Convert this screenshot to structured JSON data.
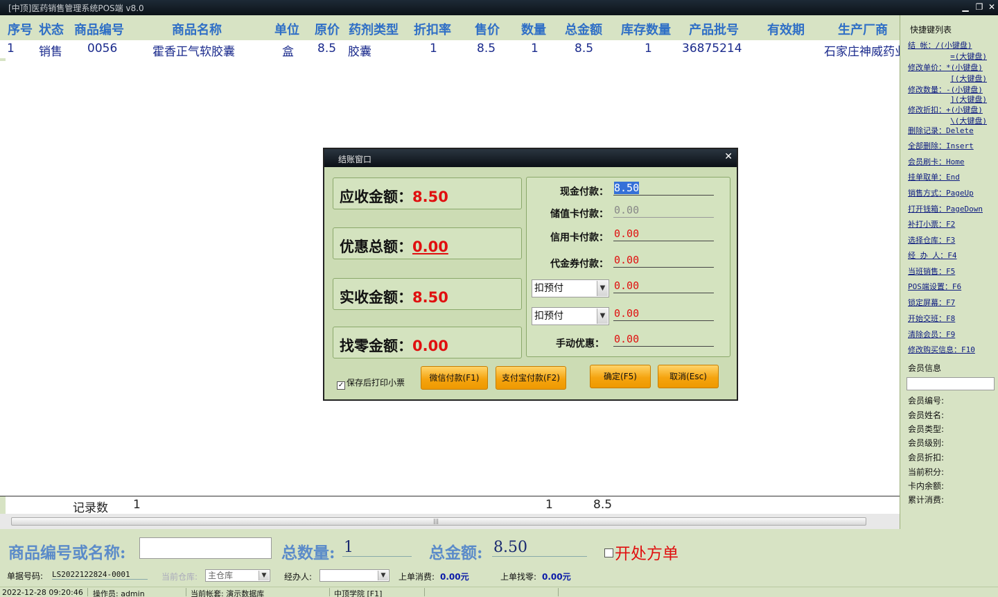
{
  "window": {
    "title": "[中顶]医药销售管理系统POS端 v8.0",
    "min_icon": "minimize-icon",
    "max_icon": "restore-icon",
    "close_icon": "close-icon"
  },
  "grid": {
    "columns": [
      "序号",
      "状态",
      "商品编号",
      "商品名称",
      "单位",
      "原价",
      "药剂类型",
      "折扣率",
      "售价",
      "数量",
      "总金额",
      "库存数量",
      "产品批号",
      "有效期",
      "生产厂商"
    ],
    "rows": [
      {
        "no": "1",
        "status": "销售",
        "code": "0056",
        "name": "霍香正气软胶囊",
        "unit": "盒",
        "orig_price": "8.5",
        "type": "胶囊",
        "discount": "1",
        "price": "8.5",
        "qty": "1",
        "total": "8.5",
        "stock": "1",
        "batch": "36875214",
        "expiry": "",
        "maker": "石家庄神威药业"
      }
    ],
    "summary": {
      "label": "记录数",
      "count": "1",
      "qty": "1",
      "total": "8.5"
    }
  },
  "sidebar": {
    "title": "快捷键列表",
    "shortcuts": [
      {
        "label": "结  帐：/(小键盘)",
        "cont": "=(大键盘)"
      },
      {
        "label": "修改单价：*(小键盘)",
        "cont": "[(大键盘)"
      },
      {
        "label": "修改数量：-(小键盘)",
        "cont": "](大键盘)"
      },
      {
        "label": "修改折扣：+(小键盘)",
        "cont": "\\(大键盘)"
      },
      {
        "label": "删除记录：Delete"
      },
      {
        "label": "全部删除：Insert"
      },
      {
        "label": "会员刷卡：Home"
      },
      {
        "label": "挂单取单：End"
      },
      {
        "label": "销售方式：PageUp"
      },
      {
        "label": "打开钱箱：PageDown"
      },
      {
        "label": "补打小票：F2"
      },
      {
        "label": "选择仓库：F3"
      },
      {
        "label": "经 办 人：F4"
      },
      {
        "label": "当班销售：F5"
      },
      {
        "label": "POS端设置：F6"
      },
      {
        "label": "锁定屏幕：F7"
      },
      {
        "label": "开始交班：F8"
      },
      {
        "label": "清除会员：F9"
      },
      {
        "label": "修改购买信息：F10"
      }
    ],
    "member": {
      "title": "会员信息",
      "fields": [
        "会员编号:",
        "会员姓名:",
        "会员类型:",
        "会员级别:",
        "会员折扣:",
        "当前积分:",
        "卡内余额:",
        "累计消费:"
      ]
    }
  },
  "bottom": {
    "search_label": "商品编号或名称:",
    "search_value": "",
    "total_qty_label": "总数量:",
    "total_qty": "1",
    "total_amount_label": "总金额:",
    "total_amount": "8.50",
    "prescription_label": "开处方单",
    "doc_no_label": "单据号码:",
    "doc_no": "LS2022122824-0001",
    "warehouse_label": "当前仓库:",
    "warehouse": "主仓库",
    "handler_label": "经办人:",
    "handler": "",
    "last_spend_label": "上单消费:",
    "last_spend": "0.00元",
    "last_change_label": "上单找零:",
    "last_change": "0.00元"
  },
  "status": {
    "datetime": "2022-12-28 09:20:46",
    "operator": "操作员: admin",
    "account": "当前帐套: 演示数据库",
    "company": "中顶学院 [F1]"
  },
  "dialog": {
    "title": "结账窗口",
    "close_icon": "close-icon",
    "receivable_label": "应收金额：",
    "receivable": "8.50",
    "discount_label": "优惠总额：",
    "discount": "0.00",
    "received_label": "实收金额：",
    "received": "8.50",
    "change_label": "找零金额：",
    "change": "0.00",
    "cash_label": "现金付款：",
    "cash": "8.50",
    "card_store_label": "储值卡付款：",
    "card_store": "0.00",
    "credit_label": "信用卡付款：",
    "credit": "0.00",
    "voucher_label": "代金券付款：",
    "voucher": "0.00",
    "prepay1_option": "扣预付",
    "prepay1": "0.00",
    "prepay2_option": "扣预付",
    "prepay2": "0.00",
    "manual_label": "手动优惠：",
    "manual": "0.00",
    "print_label": "保存后打印小票",
    "print_checked": true,
    "wechat_btn": "微信付款(F1)",
    "alipay_btn": "支付宝付款(F2)",
    "ok_btn": "确定(F5)",
    "cancel_btn": "取消(Esc)"
  }
}
